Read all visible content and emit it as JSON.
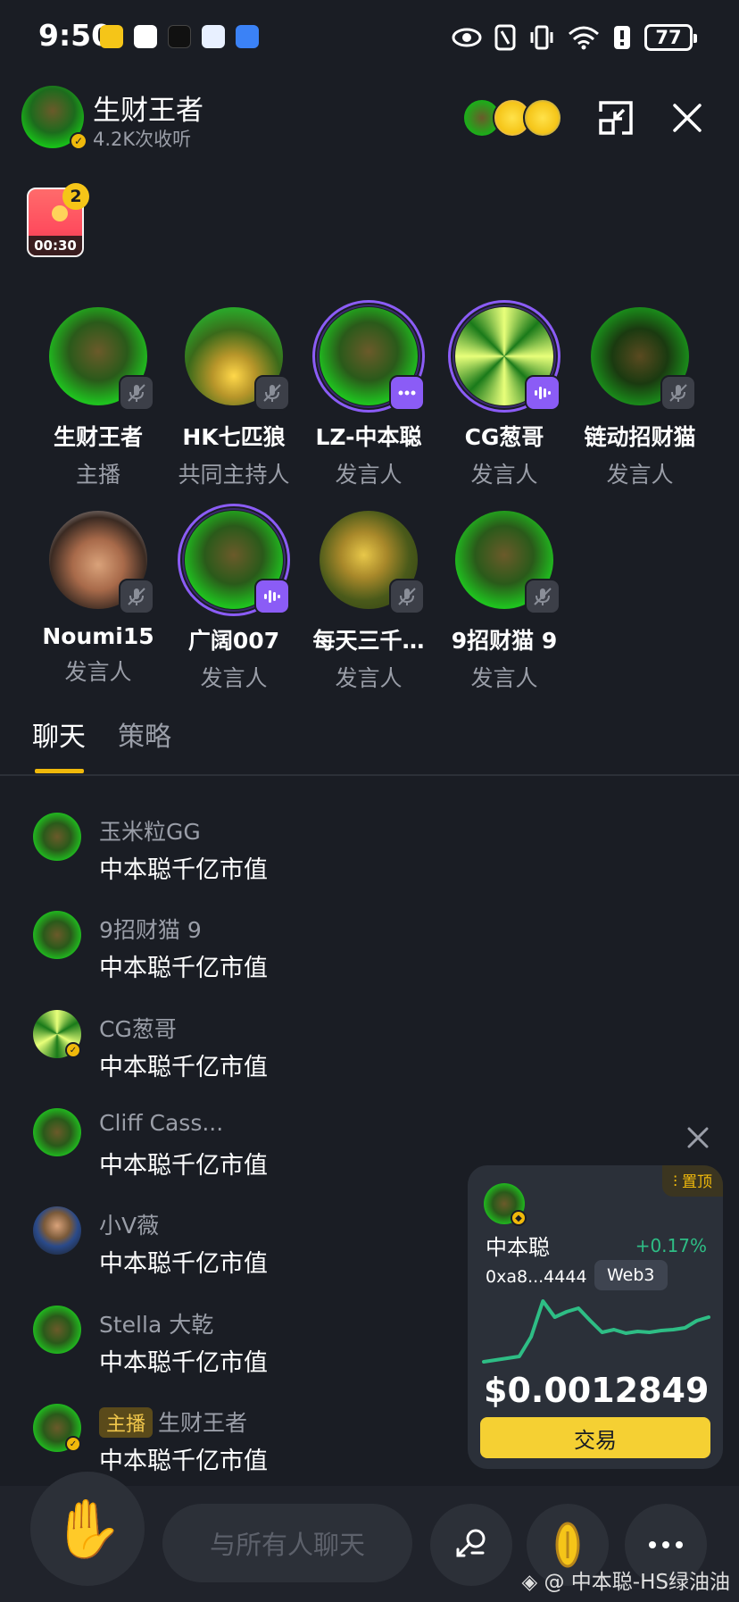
{
  "status_bar": {
    "time": "9:50",
    "battery": "77"
  },
  "room": {
    "title": "生财王者",
    "subtitle": "4.2K次收听"
  },
  "gift": {
    "count": "2",
    "timer": "00:30"
  },
  "speakers": [
    {
      "name": "生财王者",
      "role": "主播",
      "mic": "muted"
    },
    {
      "name": "HK七匹狼",
      "role": "共同主持人",
      "mic": "muted"
    },
    {
      "name": "LZ-中本聪",
      "role": "发言人",
      "mic": "more"
    },
    {
      "name": "CG葱哥",
      "role": "发言人",
      "mic": "speaking"
    },
    {
      "name": "链动招财猫",
      "role": "发言人",
      "mic": "muted"
    },
    {
      "name": "Noumi15",
      "role": "发言人",
      "mic": "muted"
    },
    {
      "name": "广阔007",
      "role": "发言人",
      "mic": "speaking"
    },
    {
      "name": "每天三千…",
      "role": "发言人",
      "mic": "muted"
    },
    {
      "name": "9招财猫 9",
      "role": "发言人",
      "mic": "muted"
    }
  ],
  "tabs": {
    "chat": "聊天",
    "strategy": "策略"
  },
  "messages": [
    {
      "user": "玉米粒GG",
      "text": "中本聪千亿市值"
    },
    {
      "user": "9招财猫 9",
      "text": "中本聪千亿市值"
    },
    {
      "user": "CG葱哥",
      "text": "中本聪千亿市值"
    },
    {
      "user": "Cliff Cass...",
      "text": "中本聪千亿市值"
    },
    {
      "user": "小V薇",
      "text": "中本聪千亿市值"
    },
    {
      "user": "Stella 大乾",
      "text": "中本聪千亿市值"
    },
    {
      "user": "生财王者",
      "tag": "主播",
      "text": "中本聪千亿市值"
    }
  ],
  "token_card": {
    "pin_label": "置顶",
    "name": "中本聪",
    "change": "+0.17%",
    "address": "0xa8...4444",
    "chain": "Web3",
    "price": "$0.0012849",
    "trade_label": "交易",
    "sparkline": [
      12,
      14,
      16,
      18,
      40,
      80,
      62,
      68,
      72,
      58,
      45,
      48,
      44,
      46,
      45,
      47,
      48,
      50,
      58,
      62
    ],
    "trend_color": "#2ebd85"
  },
  "bottom": {
    "input_placeholder": "与所有人聊天",
    "watermark": "@ 中本聪-HS绿油油"
  },
  "colors": {
    "accent": "#f0b90b",
    "speaking": "#8b5cf6",
    "positive": "#2ebd85"
  }
}
